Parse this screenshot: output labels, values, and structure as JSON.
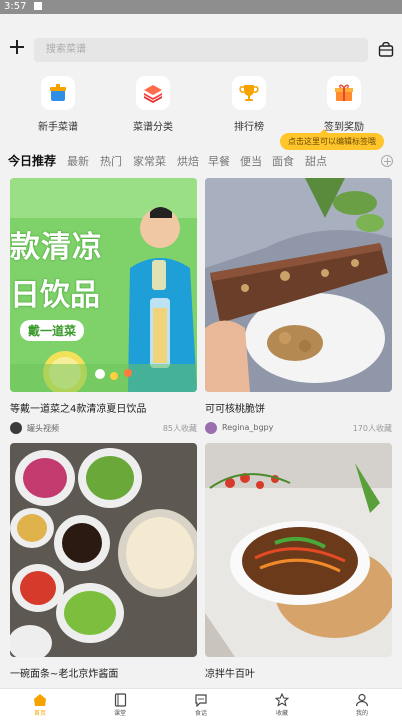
{
  "status": {
    "time": "3:57"
  },
  "search": {
    "placeholder": "搜索菜谱"
  },
  "categories": [
    {
      "label": "新手菜谱",
      "icon": "pot-icon"
    },
    {
      "label": "菜谱分类",
      "icon": "layers-icon"
    },
    {
      "label": "排行榜",
      "icon": "trophy-icon"
    },
    {
      "label": "签到奖励",
      "icon": "gift-icon"
    }
  ],
  "tooltip": "点击这里可以编辑标签哦",
  "tabs": [
    "今日推荐",
    "最新",
    "热门",
    "家常菜",
    "烘焙",
    "早餐",
    "便当",
    "面食",
    "甜点"
  ],
  "cards": [
    {
      "title": "等戴一道菜之4款清凉夏日饮品",
      "author": "罐头视频",
      "favorites": "85人收藏",
      "overlay": {
        "line1": "款清凉",
        "line2": "日饮品",
        "line3": "戴一道菜"
      }
    },
    {
      "title": "可可核桃脆饼",
      "author": "Regina_bgpy",
      "favorites": "170人收藏"
    },
    {
      "title": "一碗面条~老北京炸酱面",
      "author": "",
      "favorites": ""
    },
    {
      "title": "凉拌牛百叶",
      "author": "",
      "favorites": ""
    }
  ],
  "tabbar": [
    {
      "label": "首页",
      "icon": "home-icon"
    },
    {
      "label": "课堂",
      "icon": "book-icon"
    },
    {
      "label": "食话",
      "icon": "chat-icon"
    },
    {
      "label": "收藏",
      "icon": "star-icon"
    },
    {
      "label": "我的",
      "icon": "user-icon"
    }
  ],
  "colors": {
    "accent": "#f6a300",
    "tooltip": "#ffc52b",
    "background": "#f2f2f2"
  }
}
